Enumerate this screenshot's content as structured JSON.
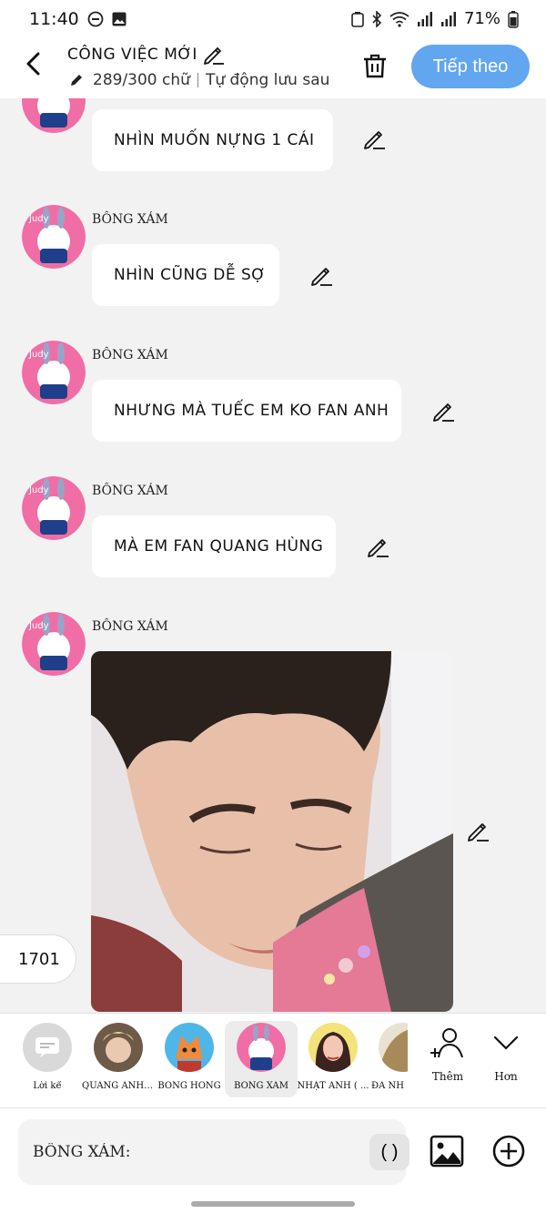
{
  "status_bar": {
    "time": "11:40",
    "battery": "71%"
  },
  "header": {
    "title": "CÔNG VIỆC MỚI",
    "char_count": "289/300 chữ",
    "autosave": "Tự động lưu sau",
    "next_button": "Tiếp theo"
  },
  "messages": [
    {
      "name": "",
      "text": "NHÌN MUỐN NỰNG 1 CÁI"
    },
    {
      "name": "BÔNG XÁM",
      "text": "NHÌN CŨNG DỄ SỢ"
    },
    {
      "name": "BÔNG XÁM",
      "text": "NHƯNG MÀ TUẾC EM KO FAN ANH"
    },
    {
      "name": "BÔNG XÁM",
      "text": "MÀ EM FAN QUANG HÙNG"
    },
    {
      "name": "BÔNG XÁM",
      "text": ""
    }
  ],
  "counter": "1701",
  "characters": [
    {
      "label": "Lời kể",
      "icon": "narration-icon"
    },
    {
      "label": "QUANG ANH ...",
      "icon": "avatar-quang-anh"
    },
    {
      "label": "BÔNG HỒNG",
      "icon": "avatar-bong-hong"
    },
    {
      "label": "BÔNG XÁM",
      "icon": "avatar-bong-xam",
      "selected": true
    },
    {
      "label": "NHẬT ÁNH ( ...",
      "icon": "avatar-nhat-anh"
    },
    {
      "label": "ĐA NH",
      "icon": "avatar-partial"
    }
  ],
  "more_actions": [
    {
      "label": "Thêm",
      "icon": "add-person-icon"
    },
    {
      "label": "Hơn",
      "icon": "chevron-down-icon"
    }
  ],
  "input": {
    "value": "BÔNG XÁM:",
    "paren_button": "( )"
  },
  "colors": {
    "accent": "#62a6f0",
    "background": "#f2f2f2",
    "bubble": "#ffffff"
  }
}
